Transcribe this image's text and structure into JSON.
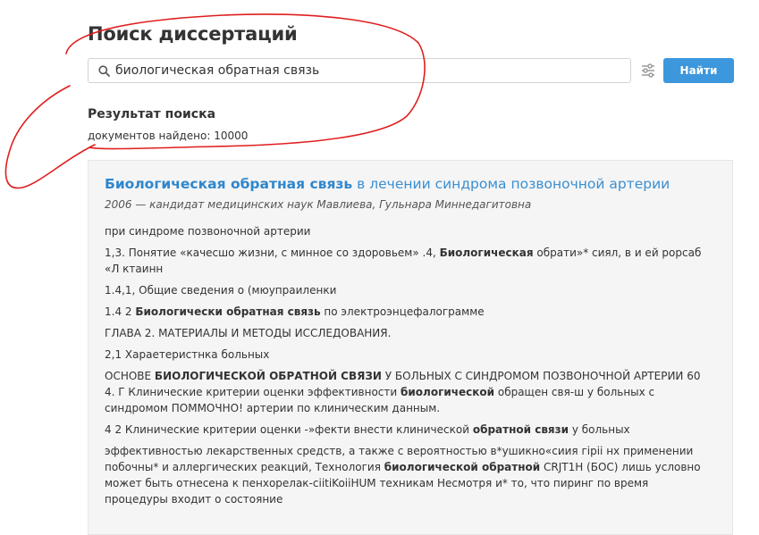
{
  "page": {
    "title": "Поиск диссертаций"
  },
  "search": {
    "value": "биологическая обратная связь",
    "submit_label": "Найти",
    "icons": {
      "search": "search-icon",
      "filter": "sliders-icon"
    }
  },
  "results": {
    "heading": "Результат поиска",
    "count_text": "документов найдено: 10000"
  },
  "result_item": {
    "title_highlight": "Биологическая обратная связь",
    "title_rest": " в лечении синдрома позвоночной артерии",
    "meta": "2006 — кандидат медицинских наук Мавлиева, Гульнара Миннедагитовна",
    "snippets": [
      {
        "segments": [
          {
            "text": "при синдроме позвоночной артерии",
            "bold": false
          }
        ]
      },
      {
        "segments": [
          {
            "text": "1,3. Понятие «качесшо жизни, с минное со здоровьем» .4, ",
            "bold": false
          },
          {
            "text": "Биологическая",
            "bold": true
          },
          {
            "text": " обрати»* сиял, в и ей рорсаб «Л ктаинн",
            "bold": false
          }
        ]
      },
      {
        "segments": [
          {
            "text": "1.4,1, Общие сведения о (мюупраиленки",
            "bold": false
          }
        ]
      },
      {
        "segments": [
          {
            "text": "1.4 2 ",
            "bold": false
          },
          {
            "text": "Биологически обратная связь",
            "bold": true
          },
          {
            "text": " по электроэнцефалограмме",
            "bold": false
          }
        ]
      },
      {
        "segments": [
          {
            "text": "ГЛАВА 2. МАТЕРИАЛЫ И МЕТОДЫ ИССЛЕДОВАНИЯ.",
            "bold": false
          }
        ]
      },
      {
        "segments": [
          {
            "text": "2,1 Хараетеристнка больных",
            "bold": false
          }
        ]
      },
      {
        "segments": [
          {
            "text": "ОСНОВЕ ",
            "bold": false
          },
          {
            "text": "БИОЛОГИЧЕСКОЙ ОБРАТНОЙ СВЯЗИ",
            "bold": true
          },
          {
            "text": " У БОЛЬНЫХ С СИНДРОМОМ ПОЗВОНОЧНОЙ АРТЕРИИ 60 4. Г Клинические критерии оценки эффективности ",
            "bold": false
          },
          {
            "text": "биологической",
            "bold": true
          },
          {
            "text": " обращен свя-ш у больных с синдромом ПОММОЧНО! артерии по клиническим данным.",
            "bold": false
          }
        ]
      },
      {
        "segments": [
          {
            "text": "4 2 Клинические критерии оценки -»фекти внести клинической ",
            "bold": false
          },
          {
            "text": "обратной связи",
            "bold": true
          },
          {
            "text": " у больных",
            "bold": false
          }
        ]
      },
      {
        "segments": [
          {
            "text": "эффективностью лекарственных средств, а также с вероятностью в*ушикно«сиия гiрii нх применении побочны* и аллергических реакций, Технология ",
            "bold": false
          },
          {
            "text": "биологической обратной",
            "bold": true
          },
          {
            "text": " CRJT1H (БОС) лишь условно может быть отнесена к пенхорелак-ciitiKoiiHUM техникам Несмотря и* то, что пиринг по время процедуры входит о состояние",
            "bold": false
          }
        ]
      }
    ]
  },
  "colors": {
    "accent": "#3d97dc",
    "link": "#3a8fd1",
    "annotation": "#e01e1e",
    "card_bg": "#f5f5f5"
  }
}
